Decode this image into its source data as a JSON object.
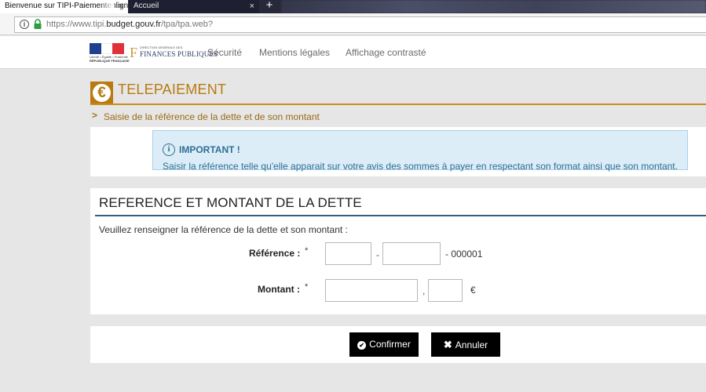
{
  "browser": {
    "tabs": [
      {
        "title": "Bienvenue sur TIPI-Paiementenlign",
        "active": true
      },
      {
        "title": "Accueil",
        "active": false
      }
    ],
    "close_glyph": "×",
    "new_tab_glyph": "+",
    "url": {
      "prefix": "https://www.tipi.",
      "domain": "budget.gouv.fr",
      "path": "/tpa/tpa.web?"
    }
  },
  "header": {
    "rf_logo_lines": [
      "Liberté • Égalité • Fraternité",
      "RÉPUBLIQUE FRANÇAISE"
    ],
    "dgfip": {
      "letter": "F",
      "small": "DIRECTION GÉNÉRALE DES",
      "big": "FINANCES PUBLIQUES"
    },
    "nav": [
      "Sécurité",
      "Mentions légales",
      "Affichage contrasté"
    ]
  },
  "page": {
    "icon_glyph": "€",
    "title": "TELEPAIEMENT",
    "step": "Saisie de la référence de la dette et de son montant",
    "important_title": "IMPORTANT !",
    "important_text": "Saisir la référence telle qu'elle apparait sur votre avis des sommes à payer en respectant son format ainsi que son montant."
  },
  "form": {
    "section_title": "REFERENCE ET MONTANT DE LA DETTE",
    "intro": "Veuillez renseigner la référence de la dette et son montant :",
    "reference_label": "Référence :",
    "amount_label": "Montant :",
    "required_mark": "*",
    "reference_separator": "-",
    "reference_suffix": "- 000001",
    "amount_separator": ",",
    "currency": "€",
    "reference_part1": "",
    "reference_part2": "",
    "amount_integer": "",
    "amount_decimal": ""
  },
  "actions": {
    "confirm": "Confirmer",
    "cancel": "Annuler"
  },
  "colors": {
    "accent_gold": "#b97a10",
    "alert_blue": "#2e6e93",
    "section_line": "#2f5f85"
  }
}
